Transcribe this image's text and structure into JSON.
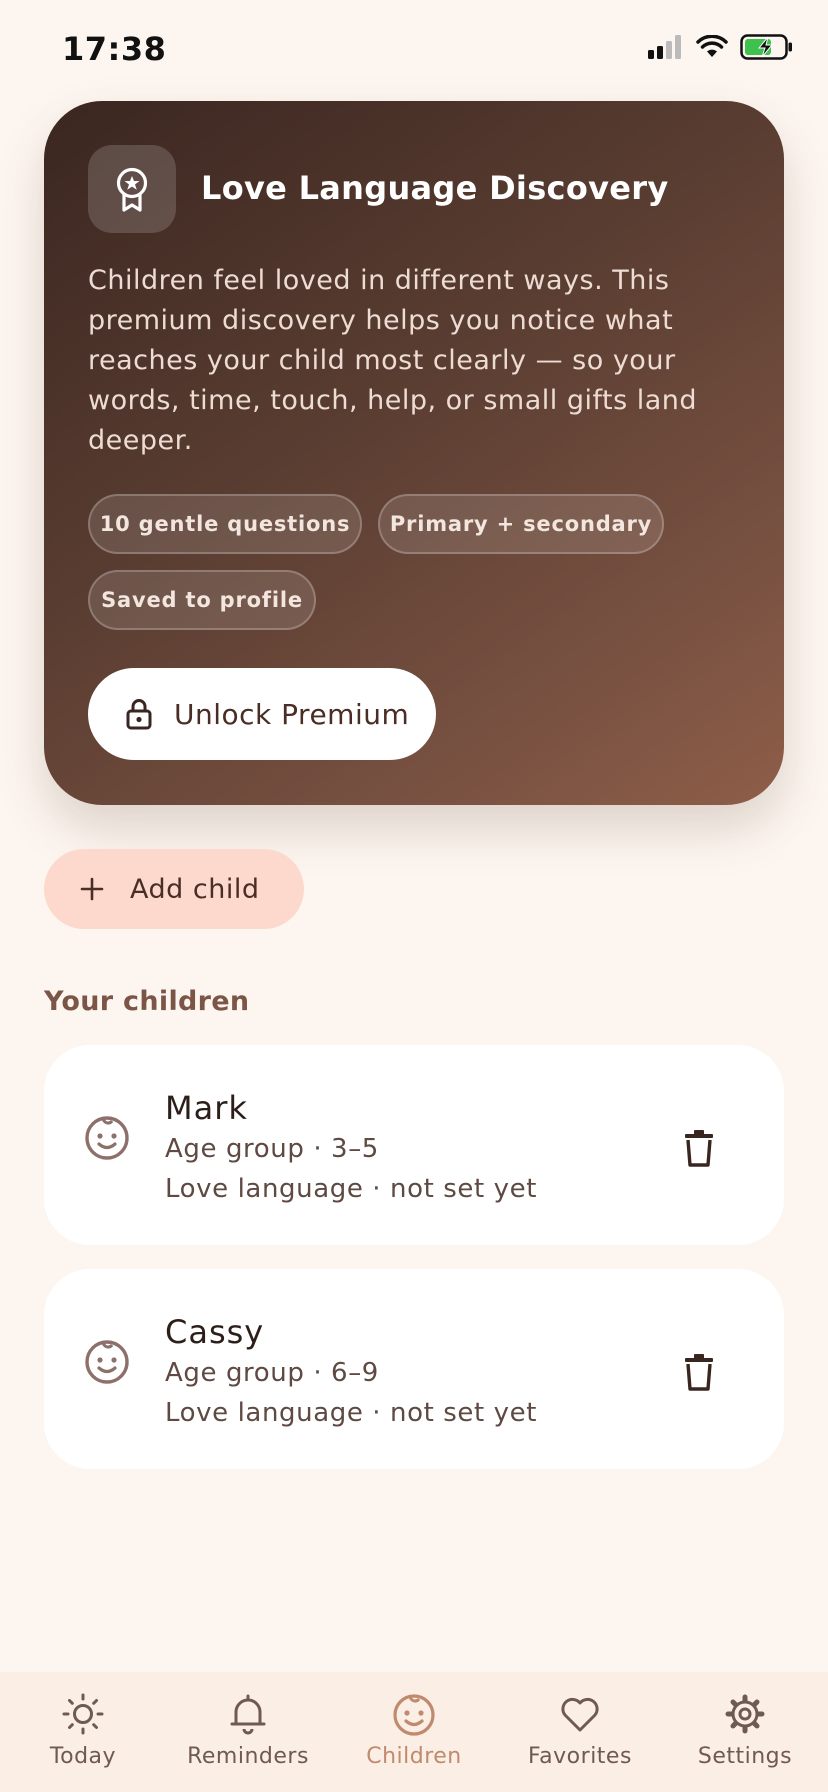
{
  "status_bar": {
    "time": "17:38"
  },
  "premium_card": {
    "title": "Love Language Discovery",
    "description": "Children feel loved in different ways. This premium discovery helps you notice what reaches your child most clearly — so your words, time, touch, help, or small gifts land deeper.",
    "chips": [
      "10 gentle questions",
      "Primary + secondary",
      "Saved to profile"
    ],
    "unlock_label": "Unlock Premium"
  },
  "add_child_label": "Add child",
  "children_section": {
    "title": "Your children",
    "children": [
      {
        "name": "Mark",
        "age_group": "Age group · 3–5",
        "love_language": "Love language · not set yet"
      },
      {
        "name": "Cassy",
        "age_group": "Age group · 6–9",
        "love_language": "Love language · not set yet"
      }
    ]
  },
  "bottom_nav": {
    "items": [
      {
        "label": "Today",
        "icon": "sun-icon"
      },
      {
        "label": "Reminders",
        "icon": "bell-icon"
      },
      {
        "label": "Children",
        "icon": "child-face-icon",
        "active": true
      },
      {
        "label": "Favorites",
        "icon": "heart-icon"
      },
      {
        "label": "Settings",
        "icon": "gear-icon"
      }
    ]
  },
  "colors": {
    "background": "#fdf6f0",
    "card_gradient_start": "#3a2620",
    "card_gradient_end": "#8e5e48",
    "add_button": "#fcd9cc",
    "nav_active": "#c08a6e",
    "nav_background": "#fbeee5"
  }
}
